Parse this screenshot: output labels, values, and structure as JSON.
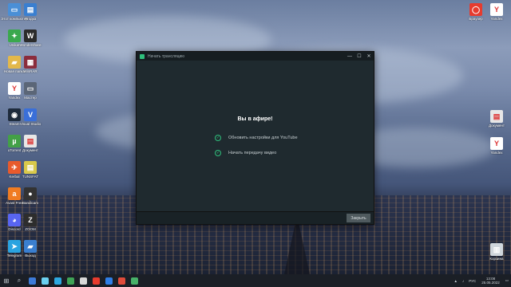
{
  "desktop": {
    "icons_left": [
      {
        "label": "Этот компьютер",
        "color": "#4a8fd6",
        "glyph": "▭"
      },
      {
        "label": "Ягодка",
        "color": "#3a7fd0",
        "glyph": "▤"
      },
      {
        "label": "Unikat",
        "color": "#3aa84d",
        "glyph": "✦"
      },
      {
        "label": "Wondershare",
        "color": "#2b2b2b",
        "glyph": "W"
      },
      {
        "label": "Новая папка",
        "color": "#e3b84a",
        "glyph": "▰"
      },
      {
        "label": "WinRAR",
        "color": "#8b2c3c",
        "glyph": "▦"
      },
      {
        "label": "Yandex",
        "color": "#ffffff",
        "glyph": "Y"
      },
      {
        "label": "Мастер",
        "color": "#5b6677",
        "glyph": "▭"
      },
      {
        "label": "Steam",
        "color": "#1e2b3c",
        "glyph": "◉"
      },
      {
        "label": "Visual Studio",
        "color": "#3a6fd8",
        "glyph": "V"
      },
      {
        "label": "uTorrent",
        "color": "#43a047",
        "glyph": "µ"
      },
      {
        "label": "Документ",
        "color": "#e7e7e7",
        "glyph": "▤"
      },
      {
        "label": "Kerbal",
        "color": "#e85a2c",
        "glyph": "✈"
      },
      {
        "label": "TUNSFAT",
        "color": "#d9c94a",
        "glyph": "▤"
      },
      {
        "label": "Avast Free",
        "color": "#f07c22",
        "glyph": "a"
      },
      {
        "label": "Bandicam",
        "color": "#333333",
        "glyph": "●"
      },
      {
        "label": "Discord",
        "color": "#5865f2",
        "glyph": "◕"
      },
      {
        "label": "ZOOM",
        "color": "#2d2d2d",
        "glyph": "Z"
      },
      {
        "label": "Telegram",
        "color": "#2aa3e0",
        "glyph": "➤"
      },
      {
        "label": "Выход",
        "color": "#3a7fd0",
        "glyph": "▰"
      }
    ],
    "icons_right": [
      {
        "label": "Браузер",
        "color": "#e63b2e",
        "glyph": "◯"
      },
      {
        "label": "Yandex",
        "color": "#ffffff",
        "glyph": "Y"
      },
      {
        "label": "Документ",
        "color": "#e7e7e7",
        "glyph": "▤"
      },
      {
        "label": "Yandex",
        "color": "#ffffff",
        "glyph": "Y"
      },
      {
        "label": "Корзина",
        "color": "#cfd6dc",
        "glyph": "▥"
      }
    ]
  },
  "window": {
    "title": "Начать трансляцию",
    "minimize": "—",
    "maximize": "☐",
    "close": "✕",
    "heading": "Вы в афире!",
    "steps": [
      {
        "label": "Обновить настройки для YouTube",
        "check": "✓"
      },
      {
        "label": "Начать передачу видео",
        "check": "✓"
      }
    ],
    "close_button": "Закрыть"
  },
  "taskbar": {
    "start": "⊞",
    "search": "⌕",
    "apps": [
      {
        "name": "explorer",
        "color": "#3d7bd8"
      },
      {
        "name": "app2",
        "color": "#6bd0f0"
      },
      {
        "name": "app3",
        "color": "#2ea8e0"
      },
      {
        "name": "app4",
        "color": "#3fa356"
      },
      {
        "name": "app5",
        "color": "#d8d8d8"
      },
      {
        "name": "yandex",
        "color": "#e63b2e"
      },
      {
        "name": "app7",
        "color": "#2f7ee6"
      },
      {
        "name": "obs",
        "color": "#e04b3a"
      },
      {
        "name": "app9",
        "color": "#48b169"
      }
    ],
    "tray": {
      "lang": "РУС",
      "time": "13:08",
      "date": "25.05.2022"
    }
  }
}
